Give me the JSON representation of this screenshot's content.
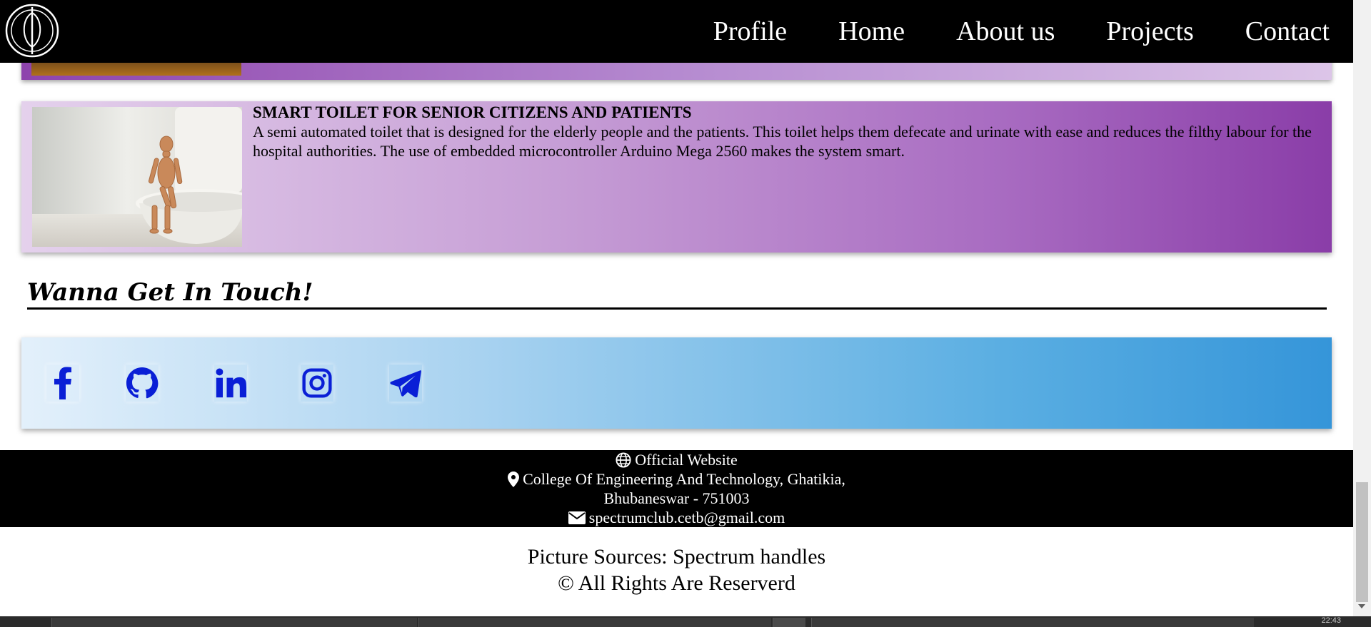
{
  "nav": {
    "logo_icon": "spectrum-logo-icon",
    "links": [
      "Profile",
      "Home",
      "About us",
      "Projects",
      "Contact"
    ]
  },
  "project": {
    "title": "SMART TOILET FOR SENIOR CITIZENS AND PATIENTS",
    "description": "A semi automated toilet that is designed for the elderly people and the patients. This toilet helps them defecate and urinate with ease and reduces the filthy labour for the hospital authorities. The use of embedded microcontroller Arduino Mega 2560 makes the system smart."
  },
  "contact": {
    "heading": "Wanna Get In Touch!",
    "social_icons": [
      "facebook-icon",
      "github-icon",
      "linkedin-icon",
      "instagram-icon",
      "telegram-icon"
    ],
    "icon_color": "#0a1fd6"
  },
  "footer": {
    "website": "Official Website",
    "address_line1": "College Of Engineering And Technology, Ghatikia,",
    "address_line2": "Bhubaneswar - 751003",
    "email": "spectrumclub.cetb@gmail.com"
  },
  "credits": {
    "sources": "Picture Sources: Spectrum handles",
    "rights": "© All Rights Are Reserverd"
  },
  "taskbar": {
    "clock": "22:43"
  },
  "colors": {
    "navbar": "#000000",
    "card_purple": "#8e44ad",
    "social_blue": "#3595d9"
  }
}
